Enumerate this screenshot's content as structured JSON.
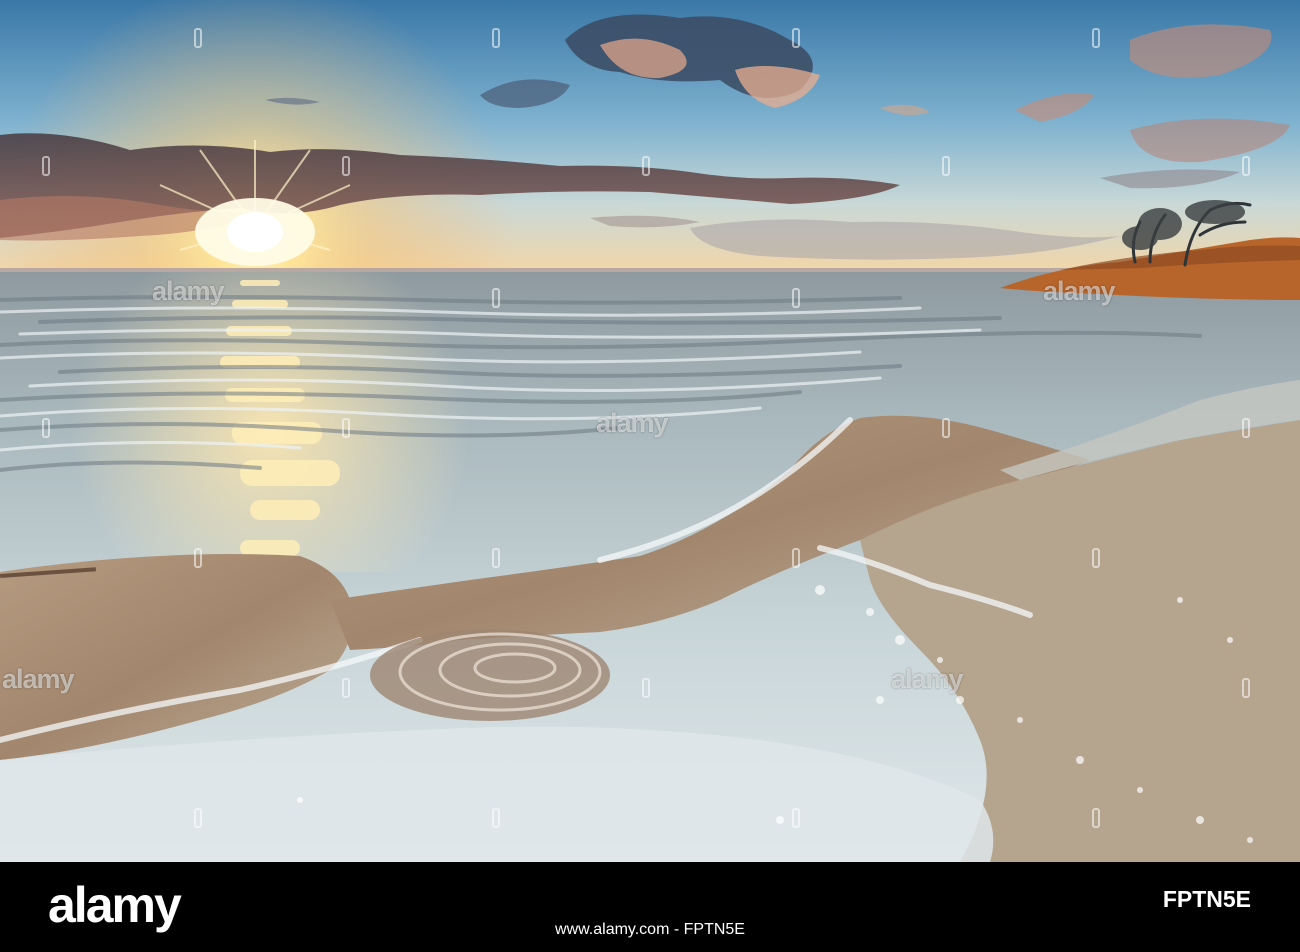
{
  "photo": {
    "subject": "sunset over lake with sandy shore and reeds"
  },
  "watermark": {
    "text": "alamy"
  },
  "footer": {
    "brand": "alamy",
    "stock_id": "FPTN5E",
    "credit": "www.alamy.com - FPTN5E"
  },
  "colors": {
    "sky_top": "#3f7fae",
    "sky_horizon": "#f7d9a0",
    "sun": "#fff3c4",
    "water": "#b9c9cc",
    "sand": "#a88f78",
    "reeds": "#b8652b",
    "footer_bg": "#000000"
  }
}
